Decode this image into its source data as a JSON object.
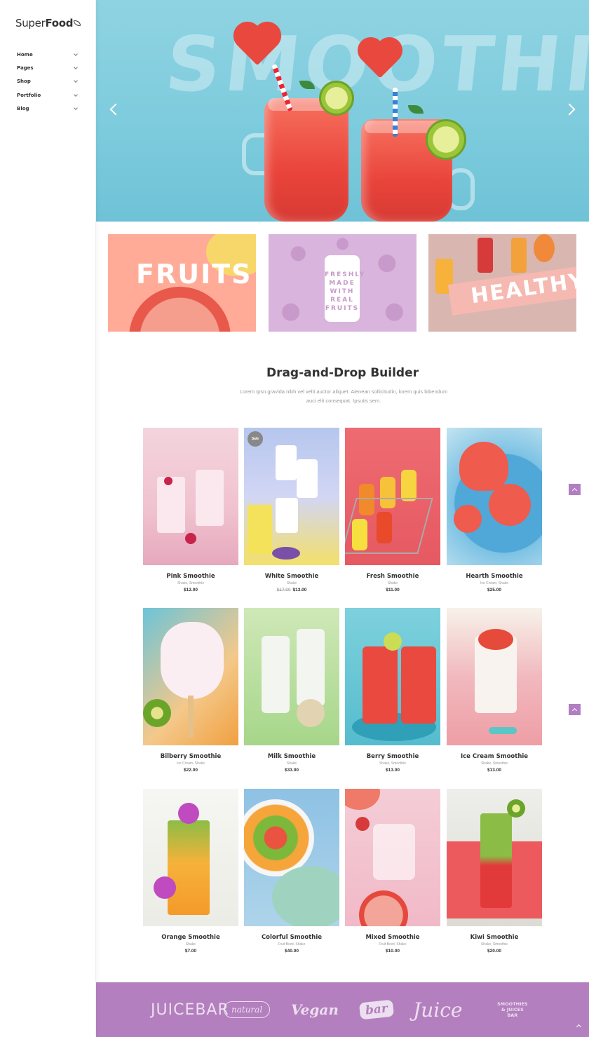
{
  "logo": {
    "light": "Super",
    "bold": "Food"
  },
  "nav": [
    {
      "label": "Home"
    },
    {
      "label": "Pages"
    },
    {
      "label": "Shop"
    },
    {
      "label": "Portfolio"
    },
    {
      "label": "Blog"
    }
  ],
  "hero": {
    "word": "SMOOTHIES"
  },
  "banners": [
    {
      "text": "FRUITS"
    },
    {
      "text": "FRESHLY MADE WITH REAL FRUITS"
    },
    {
      "text": "HEALTHY"
    }
  ],
  "section": {
    "title": "Drag-and-Drop Builder",
    "desc": "Lorem Ipsn gravida nibh vel velit auctor aliquet. Aienean sollicitudin, lorem quis bibendum auci elit consequat. Ipsutis sem."
  },
  "products": [
    {
      "name": "Pink Smoothie",
      "cat": "Shake, Smoothie",
      "price": "$12.00",
      "old_price": "",
      "sale": ""
    },
    {
      "name": "White Smoothie",
      "cat": "Shake",
      "price": "$13.00",
      "old_price": "$17.00",
      "sale": "Sale"
    },
    {
      "name": "Fresh Smoothie",
      "cat": "Shake",
      "price": "$11.00",
      "old_price": "",
      "sale": ""
    },
    {
      "name": "Hearth Smoothie",
      "cat": "Ice Cream, Shake",
      "price": "$25.00",
      "old_price": "",
      "sale": ""
    },
    {
      "name": "Bilberry Smoothie",
      "cat": "Ice Cream, Shake",
      "price": "$22.00",
      "old_price": "",
      "sale": ""
    },
    {
      "name": "Milk Smoothie",
      "cat": "Shake",
      "price": "$33.00",
      "old_price": "",
      "sale": ""
    },
    {
      "name": "Berry Smoothie",
      "cat": "Shake, Smoothie",
      "price": "$13.00",
      "old_price": "",
      "sale": ""
    },
    {
      "name": "Ice Cream Smoothie",
      "cat": "Shake, Smoothie",
      "price": "$13.00",
      "old_price": "",
      "sale": ""
    },
    {
      "name": "Orange Smoothie",
      "cat": "Shake",
      "price": "$7.00",
      "old_price": "",
      "sale": ""
    },
    {
      "name": "Colorful Smoothie",
      "cat": "Fruit Bowl, Shake",
      "price": "$40.00",
      "old_price": "",
      "sale": ""
    },
    {
      "name": "Mixed Smoothie",
      "cat": "Fruit Bowl, Shake",
      "price": "$10.00",
      "old_price": "",
      "sale": ""
    },
    {
      "name": "Kiwi Smoothie",
      "cat": "Shake, Smoothie",
      "price": "$20.00",
      "old_price": "",
      "sale": ""
    }
  ],
  "footer_logos": [
    "JUICEBAR",
    "natural",
    "Vegan",
    "bar",
    "Juice",
    "SMOOTHIES & JUICES BAR"
  ],
  "colors": {
    "accent": "#b37fbe",
    "hero": "#8fd3e2"
  }
}
